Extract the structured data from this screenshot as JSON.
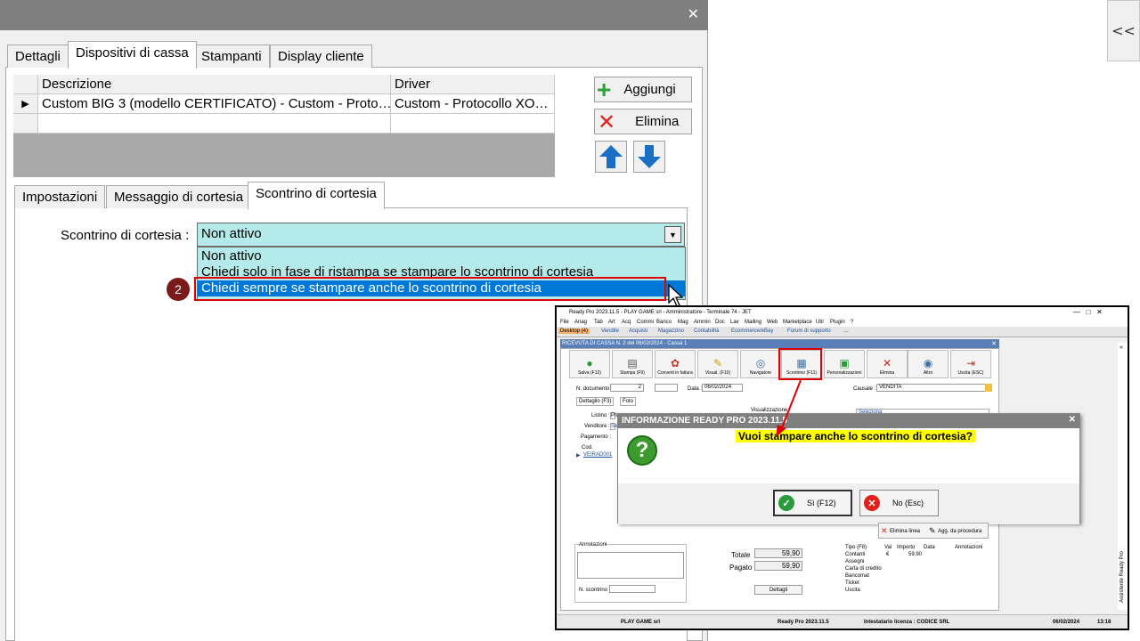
{
  "window": {
    "close": "✕"
  },
  "right": {
    "collapse": "<<"
  },
  "tabs": [
    "Dettagli",
    "Dispositivi di cassa",
    "Stampanti",
    "Display cliente"
  ],
  "grid": {
    "headers": [
      "Descrizione",
      "Driver"
    ],
    "rows": [
      {
        "marker": "▶",
        "descrizione": "Custom BIG 3 (modello CERTIFICATO) - Custom - Proto…",
        "driver": "Custom - Protocollo XO…"
      }
    ]
  },
  "buttons": {
    "aggiungi": "Aggiungi",
    "elimina": "Elimina"
  },
  "subtabs": [
    "Impostazioni",
    "Messaggio di cortesia",
    "Scontrino di cortesia"
  ],
  "field": {
    "label": "Scontrino di cortesia :",
    "value": "Non attivo"
  },
  "options": [
    "Non attivo",
    "Chiedi solo in fase di ristampa se stampare lo scontrino di cortesia",
    "Chiedi sempre se stampare anche lo scontrino di cortesia"
  ],
  "step": "2",
  "inset": {
    "title": "Ready Pro 2023.11.5 - PLAY GAME srl - Amministratore - Terminale 74 - JET",
    "menu": [
      "File",
      "Anag",
      "Tab",
      "Art",
      "Acq",
      "Commi",
      "Banco",
      "Mag",
      "Ammin",
      "Doc",
      "Lav",
      "Mailing",
      "Web",
      "Marketplace",
      "Util",
      "Plugin",
      "?"
    ],
    "tabs": [
      "Desktop (4)",
      "Vendite",
      "Acquisti",
      "Magazzino",
      "Contabilità",
      "Ecommerce/eBay",
      "Forum di supporto",
      "…"
    ],
    "doc_title": "RICEVUTA DI CASSA N. 2 del 06/02/2024 - Cassa 1",
    "toolbar": [
      "Salva (F12)",
      "Stampa (F9)",
      "Converti in fattura",
      "Visual. (F10)",
      "Navigatore",
      "Scontrino (F11)",
      "Personalizzazioni",
      "Elimina",
      "Altro",
      "Uscita (ESC)"
    ],
    "fields": {
      "ndoc_label": "N. documento :",
      "ndoc": "2",
      "data_label": "Data :",
      "data": "06/02/2024",
      "causale_label": "Causale :",
      "causale": "VENDITA"
    },
    "subtabs": [
      "Dettaglio (F3)",
      "Foto"
    ],
    "left_labels": [
      "Listino :",
      "Venditore :",
      "Pagamento :"
    ],
    "left_values": [
      "Pri",
      "Se",
      ""
    ],
    "cod_label": "Cod.",
    "cod_value": "VEIRAD001",
    "visual": "Visualizzazione",
    "seleziona": "Seleziona",
    "annotazioni": "Annotazioni",
    "nscontrino": "N. scontrino :",
    "totale_label": "Totale",
    "totale": "59,90",
    "pagato_label": "Pagato",
    "pagato": "59,90",
    "dettagli": "Dettagli",
    "elimina_linea": "Elimina linea",
    "agg": "Agg. da procedura",
    "pay_headers": [
      "Tipo (F8)",
      "Val",
      "Importo",
      "Data",
      "Annotazioni"
    ],
    "pay_rows": [
      [
        "Contanti",
        "€",
        "59,90"
      ],
      [
        "Assegni",
        "",
        ""
      ],
      [
        "Carta di credito",
        "",
        ""
      ],
      [
        "Bancomat",
        "",
        ""
      ],
      [
        "Ticket",
        "",
        ""
      ],
      [
        "Uscita",
        "",
        ""
      ]
    ],
    "dialog": {
      "title": "INFORMAZIONE READY PRO 2023.11.5",
      "message": "Vuoi stampare anche lo scontrino  di cortesia?",
      "yes": "Sì (F12)",
      "no": "No (Esc)"
    },
    "status": [
      "PLAY GAME srl",
      "Ready Pro 2023.11.5",
      "Intestatario licenza : CODICE SRL",
      "06/02/2024",
      "13:18"
    ],
    "side": "Assistente Ready Pro"
  }
}
